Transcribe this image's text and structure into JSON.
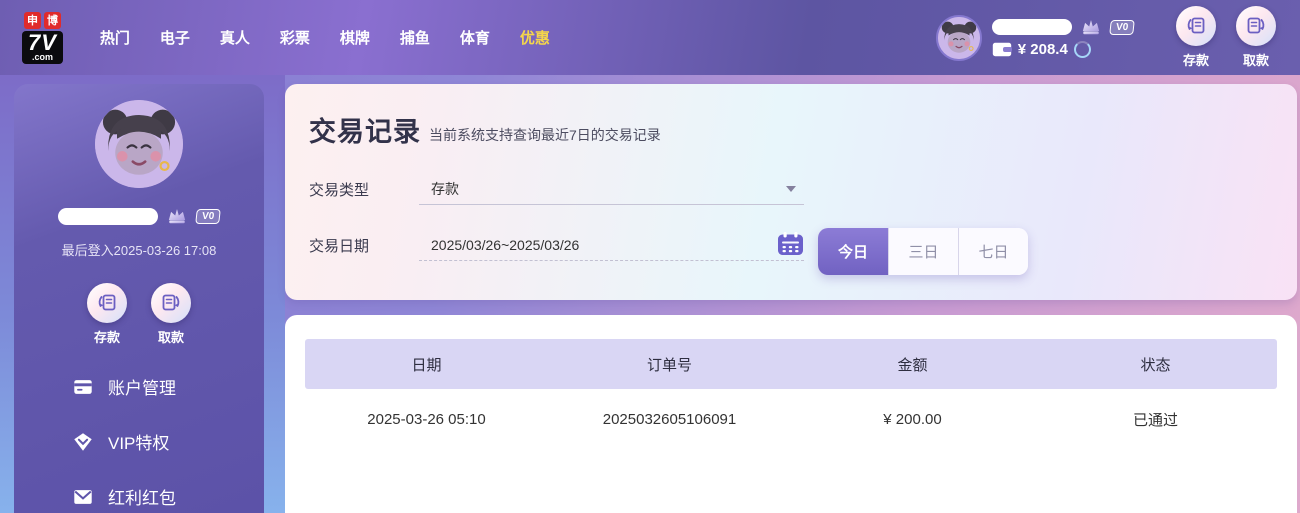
{
  "topbar": {
    "logo": {
      "tag1": "申",
      "tag2": "博",
      "name": "7V",
      "suffix": ".com"
    },
    "nav": [
      {
        "label": "热门"
      },
      {
        "label": "电子"
      },
      {
        "label": "真人"
      },
      {
        "label": "彩票"
      },
      {
        "label": "棋牌"
      },
      {
        "label": "捕鱼"
      },
      {
        "label": "体育"
      },
      {
        "label": "优惠",
        "highlight": true
      }
    ],
    "user": {
      "vip_level": "V0",
      "balance": "¥ 208.4"
    },
    "actions": {
      "deposit": "存款",
      "withdraw": "取款"
    }
  },
  "sidebar": {
    "vip_level": "V0",
    "last_login": "最后登入2025-03-26 17:08",
    "actions": {
      "deposit": "存款",
      "withdraw": "取款"
    },
    "menu": [
      {
        "label": "账户管理",
        "icon": "card-icon"
      },
      {
        "label": "VIP特权",
        "icon": "gem-icon"
      },
      {
        "label": "红利红包",
        "icon": "envelope-icon"
      }
    ]
  },
  "main": {
    "title": "交易记录",
    "subtitle": "当前系统支持查询最近7日的交易记录",
    "filters": {
      "type_label": "交易类型",
      "type_value": "存款",
      "date_label": "交易日期",
      "date_value": "2025/03/26~2025/03/26",
      "ranges": [
        {
          "label": "今日",
          "active": true
        },
        {
          "label": "三日",
          "active": false
        },
        {
          "label": "七日",
          "active": false
        }
      ]
    },
    "table": {
      "columns": [
        "日期",
        "订单号",
        "金额",
        "状态"
      ],
      "rows": [
        {
          "date": "2025-03-26 05:10",
          "order_no": "2025032605106091",
          "amount": "¥ 200.00",
          "status": "已通过"
        }
      ]
    }
  },
  "colors": {
    "accent_purple": "#7b68c8",
    "active_button": "#7d6cc8",
    "highlight_yellow": "#f5d64a",
    "table_header_bg": "#d9d6f4"
  }
}
